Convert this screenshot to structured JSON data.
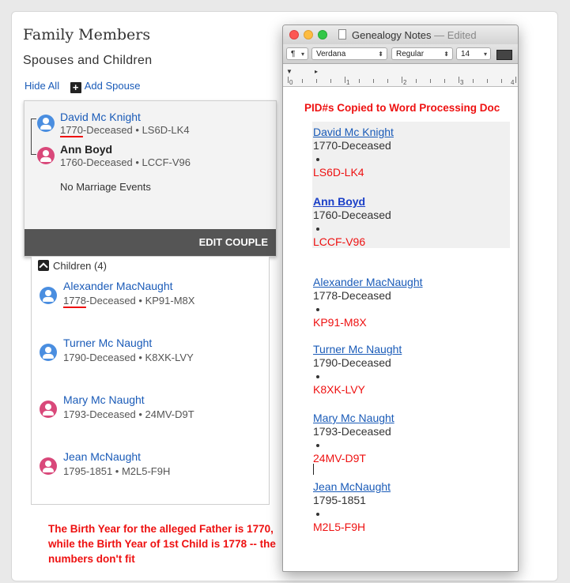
{
  "family": {
    "title": "Family Members",
    "subtitle": "Spouses and Children",
    "hide_all": "Hide All",
    "add_spouse": "Add Spouse",
    "father": {
      "name": "David Mc Knight",
      "year": "1770",
      "rest": "-Deceased • LS6D-LK4"
    },
    "mother": {
      "name": "Ann Boyd",
      "info": "1760-Deceased • LCCF-V96"
    },
    "no_marriage": "No Marriage Events",
    "edit_couple": "EDIT COUPLE",
    "children_label": "Children",
    "children_count": "(4)",
    "children": [
      {
        "name": "Alexander MacNaught",
        "year": "1778",
        "rest": "-Deceased • KP91-M8X",
        "sex": "m"
      },
      {
        "name": "Turner Mc Naught",
        "info": "1790-Deceased • K8XK-LVY",
        "sex": "m"
      },
      {
        "name": "Mary Mc Naught",
        "info": "1793-Deceased • 24MV-D9T",
        "sex": "f"
      },
      {
        "name": "Jean McNaught",
        "info": "1795-1851 • M2L5-F9H",
        "sex": "f"
      }
    ],
    "note": "The Birth Year for the alleged Father is 1770, while the Birth Year of 1st Child is 1778 -- the numbers don't fit"
  },
  "notes_window": {
    "title": "Genealogy Notes",
    "edited": "— Edited",
    "toolbar": {
      "style": "¶",
      "font": "Verdana",
      "weight": "Regular",
      "size": "14"
    },
    "ruler": [
      "0",
      "1",
      "2",
      "3",
      "4"
    ],
    "heading": "PID#s Copied to Word Processing Doc",
    "entries": [
      {
        "name": "David Mc Knight",
        "date": "1770-Deceased",
        "pid": "LS6D-LK4"
      },
      {
        "name": "Ann Boyd",
        "date": "1760-Deceased",
        "pid": "LCCF-V96"
      },
      {
        "name": "Alexander MacNaught",
        "date": "1778-Deceased",
        "pid": "KP91-M8X"
      },
      {
        "name": "Turner Mc Naught",
        "date": "1790-Deceased",
        "pid": "K8XK-LVY"
      },
      {
        "name": "Mary Mc Naught",
        "date": "1793-Deceased",
        "pid": "24MV-D9T"
      },
      {
        "name": "Jean McNaught",
        "date": "1795-1851",
        "pid": "M2L5-F9H"
      }
    ]
  }
}
